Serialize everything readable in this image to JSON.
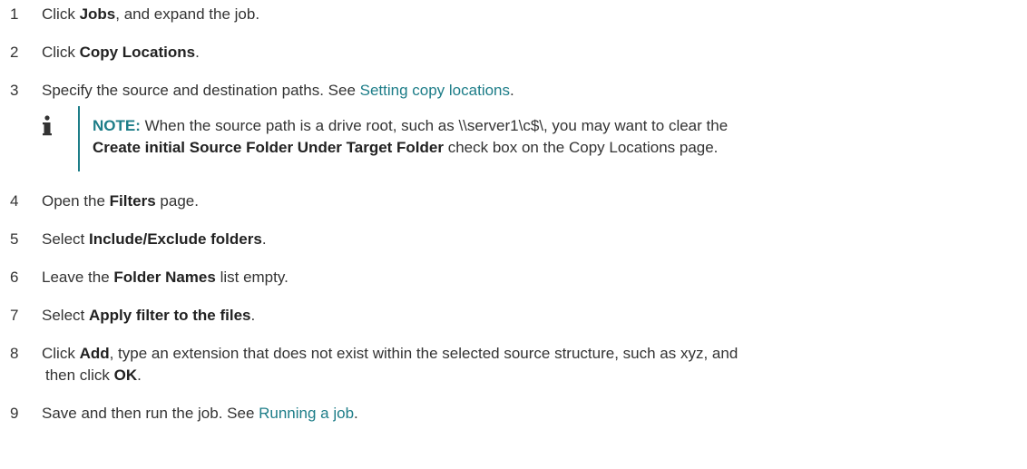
{
  "steps": [
    {
      "num": "1",
      "parts": [
        {
          "t": "Click "
        },
        {
          "t": "Jobs",
          "b": true
        },
        {
          "t": ", and expand the job."
        }
      ]
    },
    {
      "num": "2",
      "parts": [
        {
          "t": "Click "
        },
        {
          "t": "Copy Locations",
          "b": true
        },
        {
          "t": "."
        }
      ]
    },
    {
      "num": "3",
      "parts": [
        {
          "t": "Specify the source and destination paths. See "
        },
        {
          "t": "Setting copy locations",
          "link": true
        },
        {
          "t": "."
        }
      ]
    },
    {
      "num": "4",
      "parts": [
        {
          "t": "Open the "
        },
        {
          "t": "Filters",
          "b": true
        },
        {
          "t": " page."
        }
      ]
    },
    {
      "num": "5",
      "parts": [
        {
          "t": "Select "
        },
        {
          "t": "Include/Exclude folders",
          "b": true
        },
        {
          "t": "."
        }
      ]
    },
    {
      "num": "6",
      "parts": [
        {
          "t": "Leave the "
        },
        {
          "t": "Folder Names",
          "b": true
        },
        {
          "t": " list empty."
        }
      ]
    },
    {
      "num": "7",
      "parts": [
        {
          "t": "Select "
        },
        {
          "t": "Apply filter to the files",
          "b": true
        },
        {
          "t": "."
        }
      ]
    },
    {
      "num": "8",
      "parts": [
        {
          "t": "Click "
        },
        {
          "t": "Add",
          "b": true
        },
        {
          "t": ", type an extension that does not exist within the selected source structure, such as xyz, and"
        }
      ],
      "cont": [
        {
          "t": "then click "
        },
        {
          "t": "OK",
          "b": true
        },
        {
          "t": "."
        }
      ]
    },
    {
      "num": "9",
      "parts": [
        {
          "t": "Save and then run the job. See "
        },
        {
          "t": "Running a job",
          "link": true
        },
        {
          "t": "."
        }
      ]
    }
  ],
  "note": {
    "icon": "info-icon",
    "label": "NOTE:",
    "line1": " When the source path is a drive root, such as \\\\server1\\c$\\, you may want to clear the",
    "line2_bold": "Create initial Source Folder Under Target Folder",
    "line2_rest": " check box on the Copy Locations page."
  },
  "colors": {
    "link": "#1d7d88",
    "text": "#333333",
    "note_bar": "#1d7d88",
    "icon": "#333333"
  }
}
